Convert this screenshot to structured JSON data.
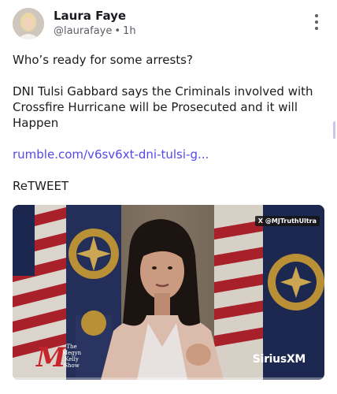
{
  "post": {
    "author_name": "Laura Faye",
    "handle": "@laurafaye",
    "separator": "•",
    "time": "1h",
    "line1": "Who’s ready for some arrests?",
    "line2": "DNI Tulsi Gabbard says the Criminals involved with Crossfire Hurricane will be Prosecuted and it will Happen",
    "link_text": "rumble.com/v6sv6xt-dni-tulsi-g...",
    "line4": "ReTWEET"
  },
  "media": {
    "watermark_top": "@MJTruthUltra",
    "watermark_x": "X",
    "watermark_brand": "SiriusXM",
    "show_logo_letter": "M",
    "show_logo_text": "The Megyn Kelly Show"
  },
  "colors": {
    "link": "#5448ee",
    "text": "#1b1b1f",
    "muted": "#5b5e66"
  },
  "icons": {
    "more": "more-vertical-icon"
  }
}
